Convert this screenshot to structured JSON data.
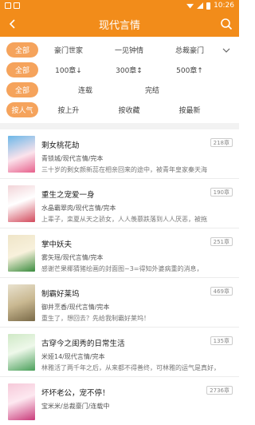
{
  "status": {
    "time": "10:26"
  },
  "header": {
    "title": "现代言情"
  },
  "filters": {
    "rows": [
      {
        "active": "全部",
        "options": [
          "豪门世家",
          "一见钟情",
          "总裁豪门"
        ]
      },
      {
        "active": "全部",
        "options": [
          "100章↓",
          "300章↕",
          "500章↑"
        ]
      },
      {
        "active": "全部",
        "options": [
          "连载",
          "完结"
        ]
      },
      {
        "active": "按人气",
        "options": [
          "按上升",
          "按收藏",
          "按最新"
        ]
      }
    ]
  },
  "books": [
    {
      "title": "剩女桃花劫",
      "meta": "青锁城/现代言情/完本",
      "desc": "三十岁的剩女颜新蕊在相亲回来的途中，被青年皇家秦天海",
      "badge": "218章",
      "cover_colors": [
        "#6cb7e8",
        "#e7608c"
      ]
    },
    {
      "title": "重生之宠爱一身",
      "meta": "水晶霸翠肉/现代言情/完本",
      "desc": "上辈子，栾夏从天之骄女，人人羡慕跌落到人人厌恶，被拖",
      "badge": "190章",
      "cover_colors": [
        "#f2d4d8",
        "#d24a5c"
      ]
    },
    {
      "title": "掌中妖夫",
      "meta": "雾矢瑶/现代言情/完本",
      "desc": "感谢芒果椰猜猪绘画的封面图~3=得知外婆病重的消息，",
      "badge": "251章",
      "cover_colors": [
        "#efe5c8",
        "#3a8c3e"
      ]
    },
    {
      "title": "制霸好莱坞",
      "meta": "御井烹香/现代言情/完本",
      "desc": "重生了，想回去？先给我制霸好莱坞！",
      "badge": "469章",
      "cover_colors": [
        "#e9e2cf",
        "#7a6a48"
      ]
    },
    {
      "title": "古穿今之闺秀的日常生活",
      "meta": "米娅14/现代言情/完本",
      "desc": "林雅活了两千年之后，从来都不得善终，可林雅的运气是真好，",
      "badge": "135章",
      "cover_colors": [
        "#cfe9c6",
        "#4aa05a"
      ]
    },
    {
      "title": "坏坏老公，宠不停！",
      "meta": "宝米米/总裁豪门/连载中",
      "desc": "",
      "badge": "2736章",
      "cover_colors": [
        "#f6c9d9",
        "#c93a7a"
      ]
    }
  ]
}
